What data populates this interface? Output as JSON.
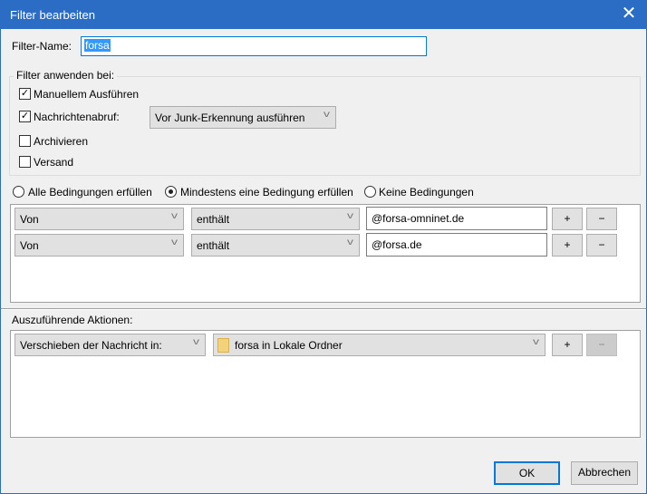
{
  "window": {
    "title": "Filter bearbeiten",
    "close_icon": "close-icon"
  },
  "filter_name": {
    "label": "Filter-Name:",
    "value": "forsa"
  },
  "apply_group": {
    "legend": "Filter anwenden bei:",
    "options": [
      {
        "label": "Manuellem Ausführen",
        "checked": true
      },
      {
        "label": "Nachrichtenabruf:",
        "checked": true
      },
      {
        "label": "Archivieren",
        "checked": false
      },
      {
        "label": "Versand",
        "checked": false
      }
    ],
    "fetch_timing": "Vor Junk-Erkennung ausführen"
  },
  "match": {
    "options": [
      "Alle Bedingungen erfüllen",
      "Mindestens eine Bedingung erfüllen",
      "Keine Bedingungen"
    ],
    "selected": 1
  },
  "conditions": [
    {
      "field": "Von",
      "operator": "enthält",
      "value": "@forsa-omninet.de"
    },
    {
      "field": "Von",
      "operator": "enthält",
      "value": "@forsa.de"
    }
  ],
  "actions_label": "Auszuführende Aktionen:",
  "actions": [
    {
      "action": "Verschieben der Nachricht in:",
      "target": "forsa in Lokale Ordner"
    }
  ],
  "add_label": "+",
  "remove_label": "−",
  "buttons": {
    "ok": "OK",
    "cancel": "Abbrechen"
  },
  "colors": {
    "titlebar": "#2b6cc4",
    "selection": "#3399ff"
  }
}
